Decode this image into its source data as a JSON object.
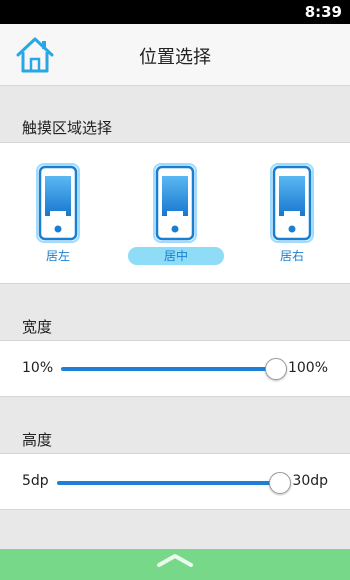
{
  "status_bar": {
    "time": "8:39"
  },
  "header": {
    "title": "位置选择",
    "home_icon": "home-icon"
  },
  "touch_area": {
    "heading": "触摸区域选择",
    "options": [
      {
        "label": "居左",
        "selected": false
      },
      {
        "label": "居中",
        "selected": true
      },
      {
        "label": "居右",
        "selected": false
      }
    ]
  },
  "width": {
    "heading": "宽度",
    "min_label": "10%",
    "max_label": "100%",
    "value_fraction": 1.0
  },
  "height": {
    "heading": "高度",
    "min_label": "5dp",
    "max_label": "30dp",
    "value_fraction": 1.0
  },
  "bottom_bar": {
    "icon": "chevron-up-icon"
  },
  "colors": {
    "accent": "#1f7fd6",
    "selected_pill": "#8fdcf7",
    "bottom_bar": "#77d88a"
  }
}
